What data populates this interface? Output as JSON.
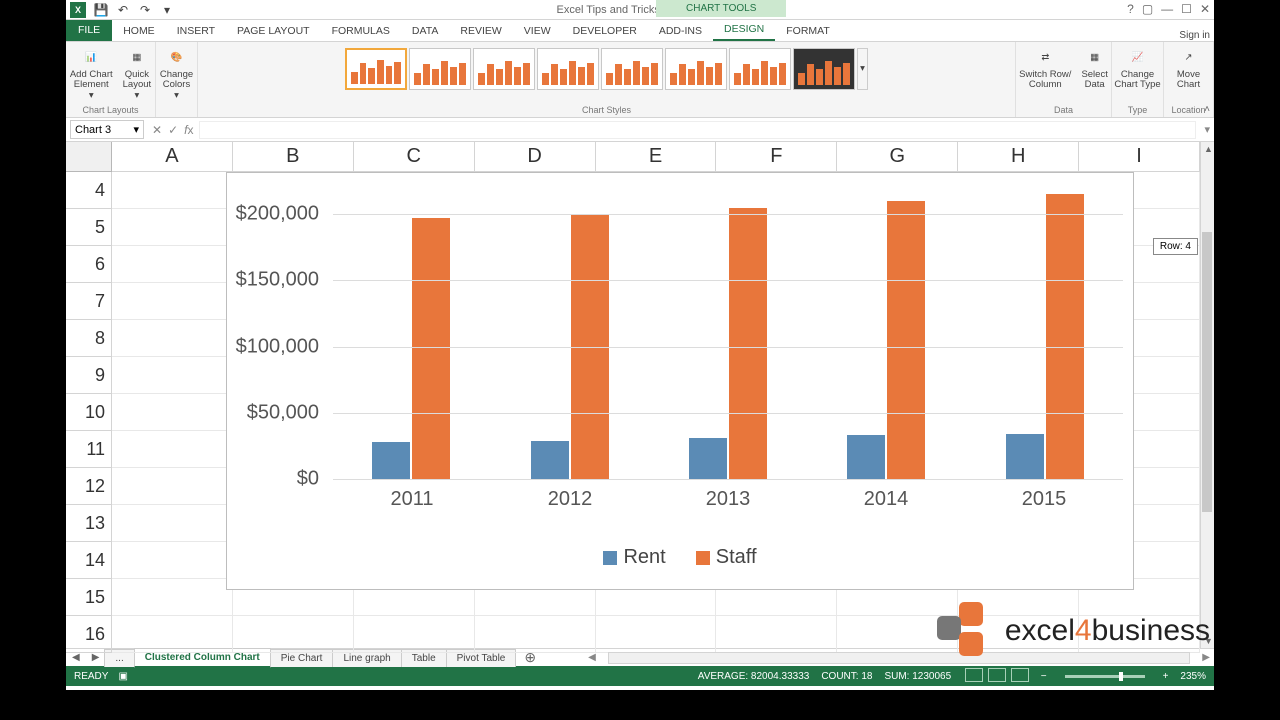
{
  "titlebar": {
    "title": "Excel Tips and Tricks Final - Excel",
    "chart_tools": "CHART TOOLS"
  },
  "signin": "Sign in",
  "tabs": {
    "file": "FILE",
    "home": "HOME",
    "insert": "INSERT",
    "pagelayout": "PAGE LAYOUT",
    "formulas": "FORMULAS",
    "data": "DATA",
    "review": "REVIEW",
    "view": "VIEW",
    "developer": "DEVELOPER",
    "addins": "ADD-INS",
    "design": "DESIGN",
    "format": "FORMAT"
  },
  "ribbon": {
    "add_el": "Add Chart\nElement",
    "quick": "Quick\nLayout",
    "colors": "Change\nColors",
    "switch": "Switch Row/\nColumn",
    "select": "Select\nData",
    "change_type": "Change\nChart Type",
    "move": "Move\nChart",
    "g_layouts": "Chart Layouts",
    "g_styles": "Chart Styles",
    "g_data": "Data",
    "g_type": "Type",
    "g_location": "Location"
  },
  "namebox": "Chart 3",
  "columns": [
    "A",
    "B",
    "C",
    "D",
    "E",
    "F",
    "G",
    "H",
    "I"
  ],
  "rows": [
    "4",
    "5",
    "6",
    "7",
    "8",
    "9",
    "10",
    "11",
    "12",
    "13",
    "14",
    "15",
    "16"
  ],
  "row_tooltip": "Row: 4",
  "chart_data": {
    "type": "bar",
    "categories": [
      "2011",
      "2012",
      "2013",
      "2014",
      "2015"
    ],
    "series": [
      {
        "name": "Rent",
        "values": [
          28000,
          29000,
          31000,
          33000,
          34000
        ]
      },
      {
        "name": "Staff",
        "values": [
          197000,
          200000,
          205000,
          210000,
          215000
        ]
      }
    ],
    "ylabels": [
      "$0",
      "$50,000",
      "$100,000",
      "$150,000",
      "$200,000"
    ],
    "ylim": [
      0,
      225000
    ],
    "xlabel": "",
    "ylabel": "",
    "title": ""
  },
  "legend": {
    "rent": "Rent",
    "staff": "Staff"
  },
  "sheets": {
    "active": "Clustered Column Chart",
    "others": [
      "Pie Chart",
      "Line graph",
      "Table",
      "Pivot Table"
    ],
    "ellipsis": "..."
  },
  "status": {
    "ready": "READY",
    "avg": "AVERAGE: 82004.33333",
    "count": "COUNT: 18",
    "sum": "SUM: 1230065",
    "zoom": "235%"
  },
  "watermark": "excel4business",
  "colors": {
    "rent": "#5b8bb5",
    "staff": "#e8763b"
  }
}
